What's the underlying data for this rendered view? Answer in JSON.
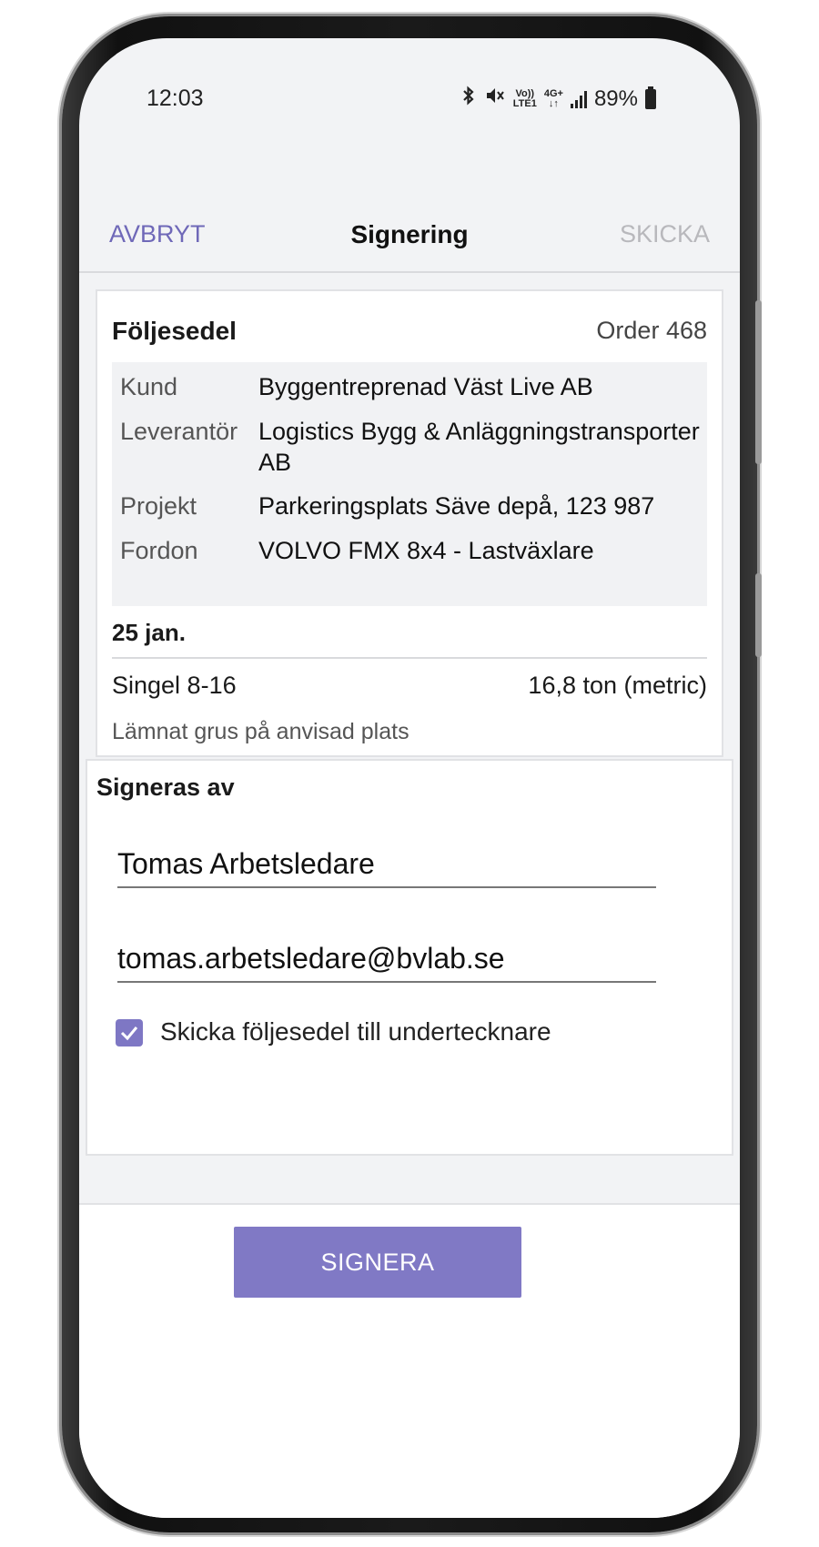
{
  "status": {
    "time": "12:03",
    "volte_top": "Vo))",
    "volte_bottom": "LTE1",
    "net_top": "4G+",
    "net_bottom": "↓↑",
    "battery": "89%",
    "icons": [
      "bluetooth-icon",
      "mute-icon",
      "volte-icon",
      "4g-icon",
      "signal-icon",
      "battery-icon"
    ]
  },
  "header": {
    "cancel": "AVBRYT",
    "title": "Signering",
    "send": "SKICKA"
  },
  "note": {
    "title": "Följesedel",
    "order": "Order 468",
    "rows": [
      {
        "label": "Kund",
        "value": "Byggentreprenad Väst Live AB"
      },
      {
        "label": "Leverantör",
        "value": "Logistics Bygg & Anläggningstransporter AB"
      },
      {
        "label": "Projekt",
        "value": "Parkeringsplats Säve depå, 123 987"
      },
      {
        "label": "Fordon",
        "value": "VOLVO FMX 8x4  - Lastväxlare"
      }
    ],
    "date": "25 jan.",
    "item": {
      "name": "Singel 8-16",
      "quantity": "16,8 ton (metric)",
      "comment": "Lämnat grus på anvisad plats"
    }
  },
  "signing": {
    "title": "Signeras av",
    "name_value": "Tomas Arbetsledare",
    "email_value": "tomas.arbetsledare@bvlab.se",
    "send_copy_checked": true,
    "send_copy_label": "Skicka följesedel till undertecknare"
  },
  "actions": {
    "sign": "SIGNERA"
  },
  "colors": {
    "accent": "#7e77c4",
    "link": "#6f68b8",
    "disabled": "#b8b8bc",
    "background": "#f2f3f5"
  }
}
